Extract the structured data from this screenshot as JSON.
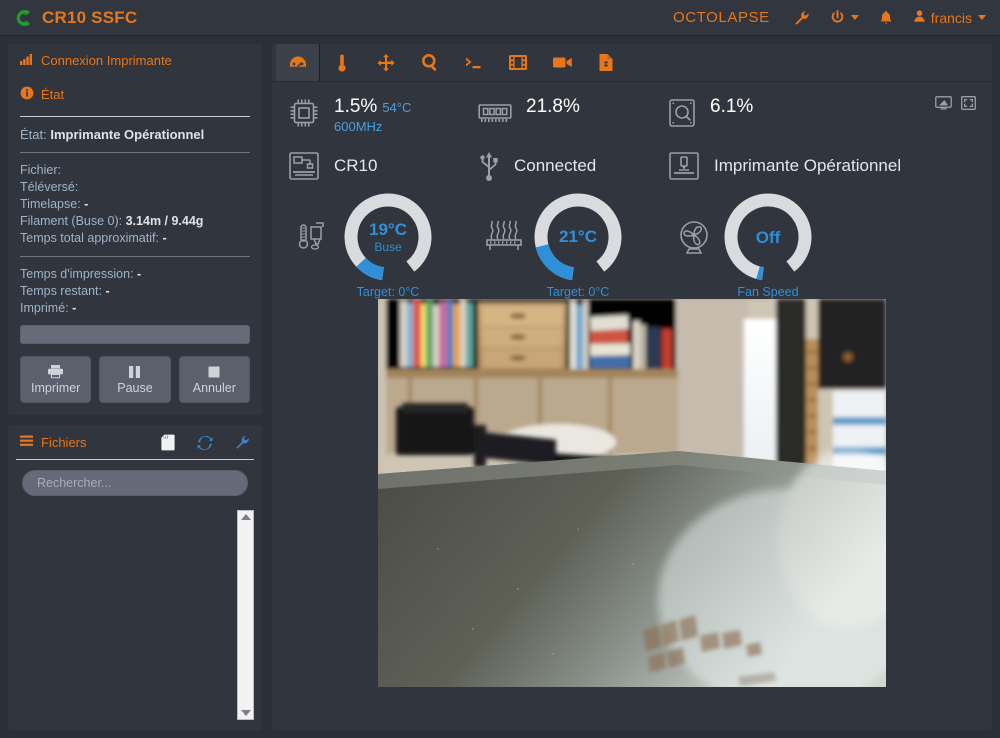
{
  "header": {
    "brand": "CR10 SSFC",
    "logo_icon": "octoprint-logo-icon",
    "octolapse": "OCTOLAPSE",
    "wrench_icon": "wrench-icon",
    "power_icon": "power-icon",
    "bell_icon": "bell-icon",
    "user_icon": "user-icon",
    "username": "francis"
  },
  "sidebar": {
    "connection": {
      "label": "Connexion Imprimante",
      "icon": "signal-bars-icon"
    },
    "state": {
      "label": "État",
      "icon": "info-circle-icon"
    },
    "state_body": {
      "state_key": "État:",
      "state_value": "Imprimante Opérationnel",
      "lines": [
        {
          "key": "Fichier:",
          "value": ""
        },
        {
          "key": "Téléversé:",
          "value": ""
        },
        {
          "key": "Timelapse:",
          "value": "-"
        },
        {
          "key": "Filament (Buse 0):",
          "value": "3.14m / 9.44g"
        },
        {
          "key": "Temps total approximatif:",
          "value": "-"
        }
      ],
      "lines2": [
        {
          "key": "Temps d'impression:",
          "value": "-"
        },
        {
          "key": "Temps restant:",
          "value": "-"
        },
        {
          "key": "Imprimé:",
          "value": "-"
        }
      ],
      "progress_percent": 0
    },
    "buttons": [
      {
        "label": "Imprimer",
        "icon": "printer-icon"
      },
      {
        "label": "Pause",
        "icon": "pause-icon"
      },
      {
        "label": "Annuler",
        "icon": "stop-icon"
      }
    ],
    "files": {
      "label": "Fichiers",
      "icon": "list-icon",
      "actions": [
        "sd-card-icon",
        "refresh-icon",
        "wrench-icon"
      ],
      "search_placeholder": "Rechercher...",
      "search_value": "",
      "items": []
    }
  },
  "main": {
    "tabs": [
      {
        "name": "dashboard",
        "icon": "gauge-icon",
        "active": true
      },
      {
        "name": "temperature",
        "icon": "thermometer-icon",
        "active": false
      },
      {
        "name": "control",
        "icon": "move-arrows-icon",
        "active": false
      },
      {
        "name": "gcode-viewer",
        "icon": "magnifier-icon",
        "active": false
      },
      {
        "name": "terminal",
        "icon": "terminal-icon",
        "active": false
      },
      {
        "name": "timelapse",
        "icon": "film-icon",
        "active": false
      },
      {
        "name": "webcam",
        "icon": "video-camera-icon",
        "active": false
      },
      {
        "name": "file-info",
        "icon": "file-icon",
        "active": false
      }
    ],
    "corner_icons": [
      "screen-icon",
      "fullscreen-icon"
    ],
    "stats_row1": [
      {
        "icon": "cpu-icon",
        "value": "1.5%",
        "temp": "54°C",
        "sub": "600MHz"
      },
      {
        "icon": "ram-icon",
        "value": "21.8%",
        "temp": "",
        "sub": ""
      },
      {
        "icon": "disk-icon",
        "value": "6.1%",
        "temp": "",
        "sub": ""
      }
    ],
    "stats_row2": [
      {
        "icon": "printer-profile-icon",
        "label": "CR10"
      },
      {
        "icon": "usb-icon",
        "label": "Connected"
      },
      {
        "icon": "printer-status-icon",
        "label": "Imprimante Opérationnel"
      }
    ],
    "gauges": [
      {
        "icon": "extruder-thermometer-icon",
        "value": "19°C",
        "name": "Buse",
        "target": "Target: 0°C",
        "arc_percent": 12
      },
      {
        "icon": "heated-bed-icon",
        "value": "21°C",
        "name": "",
        "target": "Target: 0°C",
        "arc_percent": 21
      },
      {
        "icon": "fan-icon",
        "value": "Off",
        "name": "",
        "target": "Fan Speed",
        "arc_percent": 2
      }
    ]
  },
  "colors": {
    "accent": "#e8761a",
    "blue": "#2f8fd8",
    "panel": "#31353d",
    "background": "#2b2f37",
    "text": "#dfe3e8"
  }
}
